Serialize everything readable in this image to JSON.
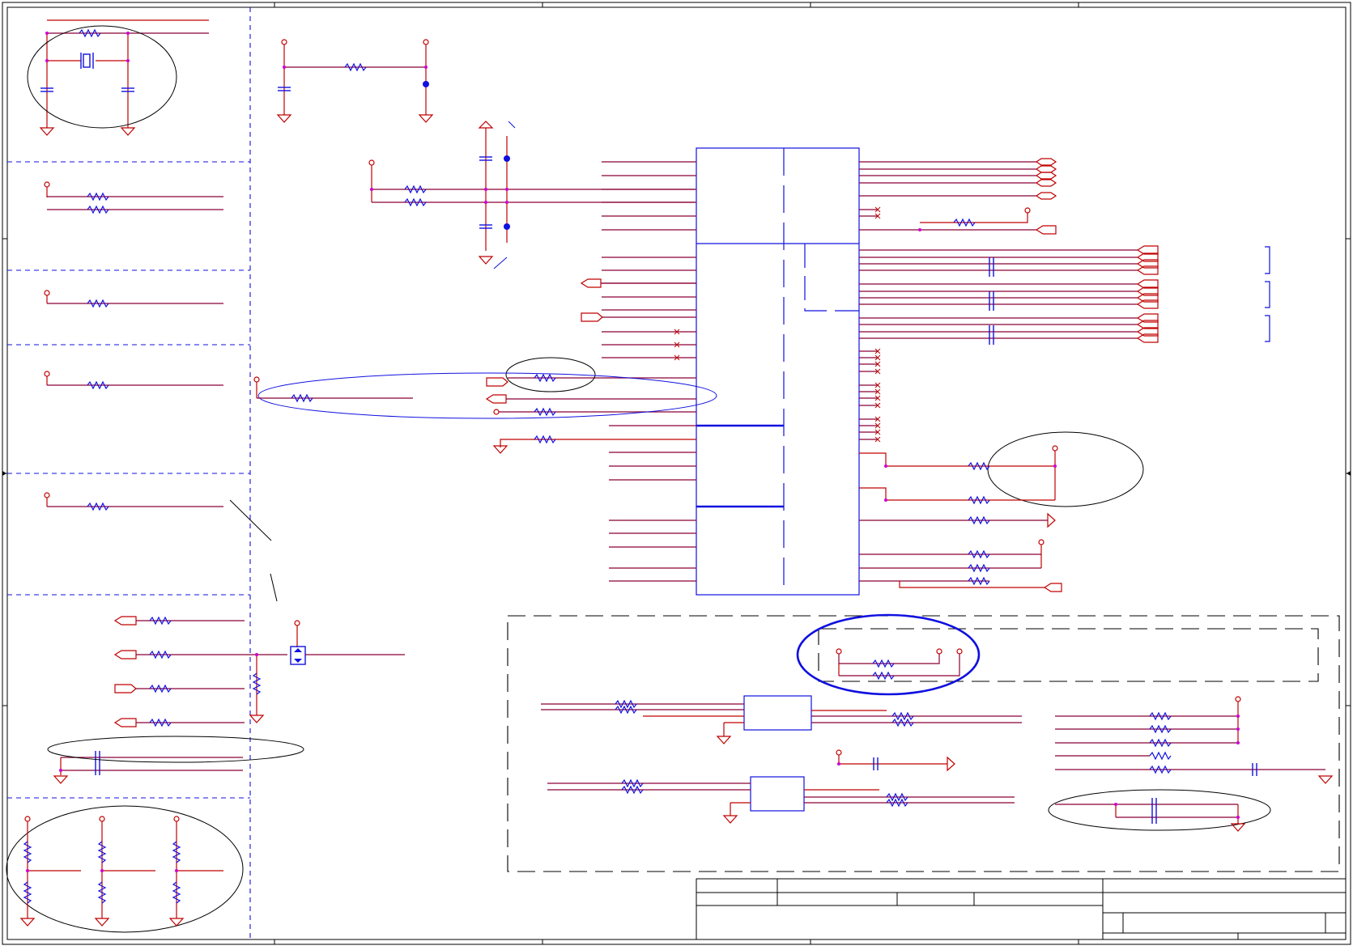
{
  "sheet": {
    "title_block": {
      "title": "",
      "size": "",
      "document_number": "",
      "revision": "",
      "date": "",
      "sheet": ""
    }
  },
  "colors": {
    "wire": "#c00000",
    "wire_alt": "#8b0036",
    "component": "#1010e0",
    "junction": "#d000d0",
    "annotation": "#000000"
  },
  "icons": {
    "ground": "ground-icon",
    "power_pin": "power-pin-icon",
    "resistor": "resistor-icon",
    "capacitor": "capacitor-icon",
    "crystal": "crystal-icon",
    "mosfet": "mosfet-icon",
    "port": "port-arrow-icon",
    "no_connect": "no-connect-icon"
  }
}
